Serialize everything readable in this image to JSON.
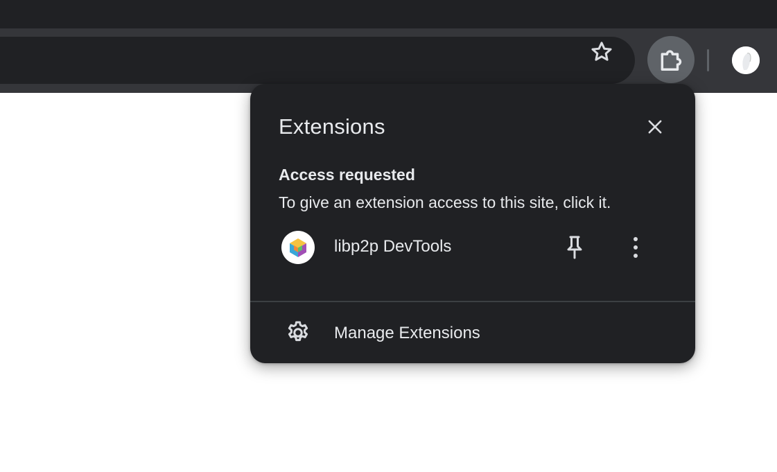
{
  "colors": {
    "tabstrip_bg": "#202124",
    "toolbar_bg": "#35363a",
    "popup_bg": "#202124",
    "text_primary": "#e8eaed",
    "icon_color": "#dadce0"
  },
  "toolbar": {
    "star_icon": "star-icon",
    "extensions_icon": "puzzle-icon",
    "avatar_icon": "profile-avatar"
  },
  "popup": {
    "title": "Extensions",
    "close_icon": "close-icon",
    "section_title": "Access requested",
    "section_description": "To give an extension access to this site, click it.",
    "extensions": [
      {
        "name": "libp2p DevTools",
        "icon": "libp2p-cube-icon",
        "pin_icon": "pin-icon",
        "more_icon": "more-vert-icon"
      }
    ],
    "manage_label": "Manage Extensions",
    "manage_icon": "gear-icon"
  }
}
